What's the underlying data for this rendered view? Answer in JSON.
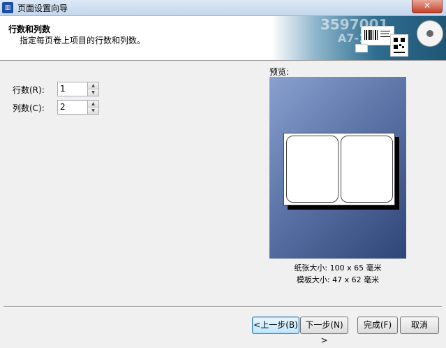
{
  "window": {
    "title": "页面设置向导",
    "close_label": "✕",
    "app_icon": "wizard-app-icon"
  },
  "header": {
    "title": "行数和列数",
    "subtitle": "指定每页卷上项目的行数和列数。",
    "banner_text_1": "3597001",
    "banner_text_2": "A7-118"
  },
  "form": {
    "rows_label": "行数(R):",
    "rows_value": "1",
    "cols_label": "列数(C):",
    "cols_value": "2"
  },
  "preview": {
    "label": "预览:",
    "paper_size": "纸张大小: 100 x 65 毫米",
    "template_size": "模板大小: 47 x 62 毫米",
    "label_columns": 2,
    "label_rows": 1
  },
  "buttons": {
    "back": "<上一步(B)",
    "next": "下一步(N) >",
    "finish": "完成(F)",
    "cancel": "取消"
  }
}
